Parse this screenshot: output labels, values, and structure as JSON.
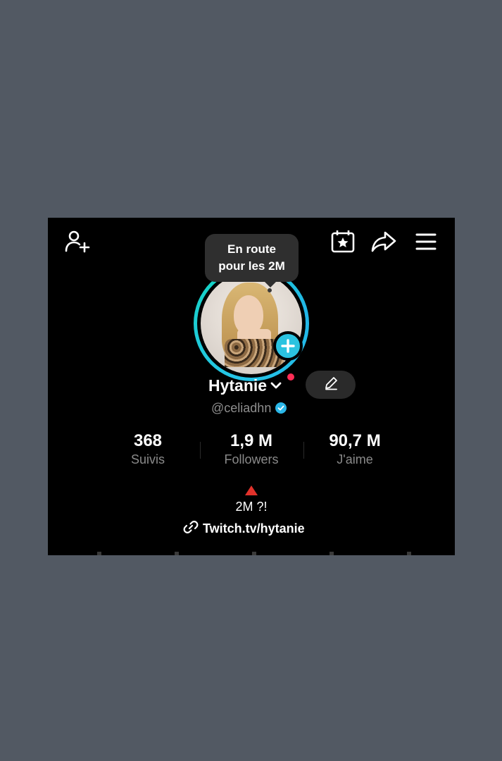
{
  "tooltip": {
    "line1": "En route",
    "line2": "pour les 2M"
  },
  "profile": {
    "name": "Hytanie",
    "handle": "@celiadhn"
  },
  "stats": [
    {
      "value": "368",
      "label": "Suivis"
    },
    {
      "value": "1,9 M",
      "label": "Followers"
    },
    {
      "value": "90,7 M",
      "label": "J'aime"
    }
  ],
  "bio": {
    "text": "2M ?!",
    "link": "Twitch.tv/hytanie"
  },
  "icons": {
    "top_left": "add-user-icon",
    "top_right": [
      "calendar-star-icon",
      "share-icon",
      "menu-icon"
    ]
  },
  "colors": {
    "accent": "#2bc3e0",
    "live_dot": "#ff2d55",
    "background": "#000000"
  }
}
